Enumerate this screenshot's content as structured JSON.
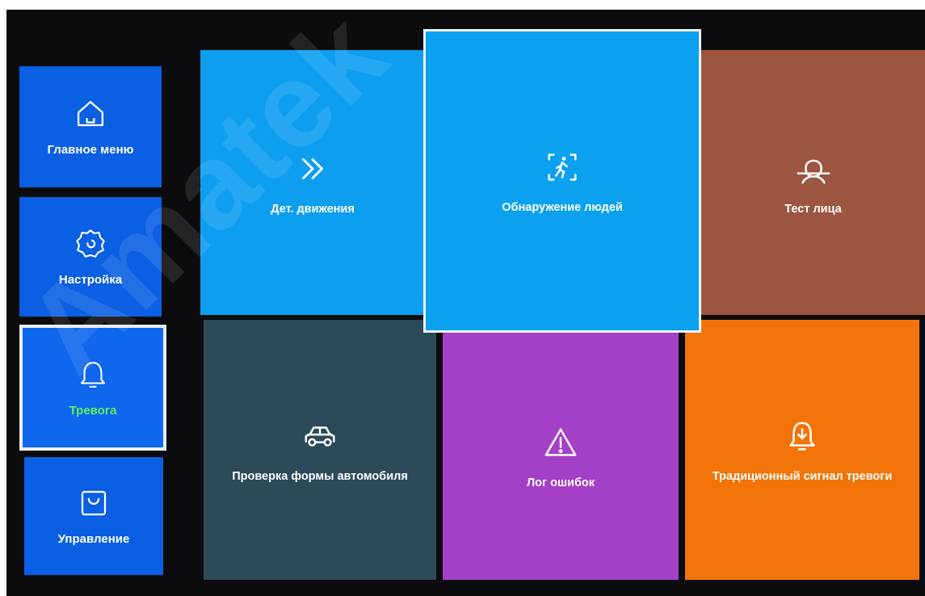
{
  "sidebar": {
    "items": [
      {
        "label": "Главное меню",
        "icon": "home-icon"
      },
      {
        "label": "Настройка",
        "icon": "gear-icon"
      },
      {
        "label": "Тревога",
        "icon": "bell-icon",
        "active": true,
        "label_color": "#5ff060"
      },
      {
        "label": "Управление",
        "icon": "shopping-bag-icon"
      }
    ]
  },
  "tiles": [
    {
      "label": "Дет. движения",
      "icon": "double-chevron-right-icon",
      "color": "#0e9ef0"
    },
    {
      "label": "Обнаружение людей",
      "icon": "person-detection-icon",
      "color": "#0ba1ef",
      "selected": true
    },
    {
      "label": "Тест лица",
      "icon": "face-icon",
      "color": "#9c5640"
    },
    {
      "label": "Проверка формы автомобиля",
      "icon": "car-icon",
      "color": "#2d4a58"
    },
    {
      "label": "Лог ошибок",
      "icon": "warning-icon",
      "color": "#a340c6"
    },
    {
      "label": "Традиционный сигнал тревоги",
      "icon": "alarm-bell-icon",
      "color": "#f27408"
    }
  ],
  "watermark": "Amatek"
}
